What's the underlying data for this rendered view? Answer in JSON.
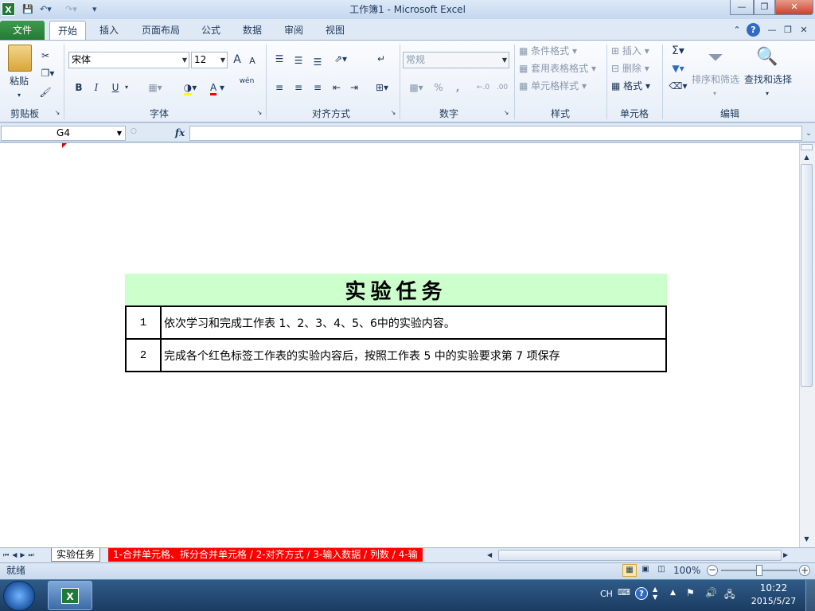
{
  "window": {
    "title": "工作簿1 - Microsoft Excel",
    "app_icon": "excel-icon",
    "qat_icons": [
      "save-icon",
      "undo-icon",
      "redo-icon",
      "customize-qat-icon"
    ]
  },
  "tabs": {
    "file": "文件",
    "items": [
      "开始",
      "插入",
      "页面布局",
      "公式",
      "数据",
      "审阅",
      "视图"
    ],
    "active": "开始"
  },
  "ribbon": {
    "clipboard": {
      "label": "剪贴板",
      "paste": "粘贴"
    },
    "font": {
      "label": "字体",
      "font_name": "宋体",
      "font_size": "12",
      "bold": "B",
      "italic": "I",
      "underline": "U",
      "grow": "A",
      "shrink": "A",
      "font_color": "A",
      "phonetic": "wén"
    },
    "alignment": {
      "label": "对齐方式"
    },
    "number": {
      "label": "数字",
      "format": "常规",
      "percent": "%",
      "comma": ","
    },
    "styles": {
      "label": "样式",
      "conditional": "条件格式",
      "table_format": "套用表格格式",
      "cell_styles": "单元格样式"
    },
    "cells": {
      "label": "单元格",
      "insert": "插入",
      "delete": "删除",
      "format": "格式"
    },
    "editing": {
      "label": "编辑",
      "sum": "Σ",
      "sort_filter": "排序和筛选",
      "find_select": "查找和选择"
    }
  },
  "formula_bar": {
    "cell_ref": "G4",
    "fx": "fx",
    "formula": ""
  },
  "sheet": {
    "title": "实验任务",
    "title_bg": "#ccffcc",
    "rows": [
      {
        "no": "1",
        "text": "依次学习和完成工作表 1、2、3、4、5、6中的实验内容。"
      },
      {
        "no": "2",
        "text": "完成各个红色标签工作表的实验内容后，按照工作表 5 中的实验要求第 7 项保存"
      }
    ]
  },
  "sheet_tabs": {
    "active": "实验任务",
    "others": [
      "1-合并单元格、拆分合并单元格",
      "2-对齐方式",
      "3-输入数据",
      "列数",
      "4-输"
    ],
    "tab_color": "#ff0000"
  },
  "status": {
    "ready": "就绪",
    "zoom": "100%"
  },
  "taskbar": {
    "lang": "CH",
    "time": "10:22",
    "date": "2015/5/27"
  }
}
